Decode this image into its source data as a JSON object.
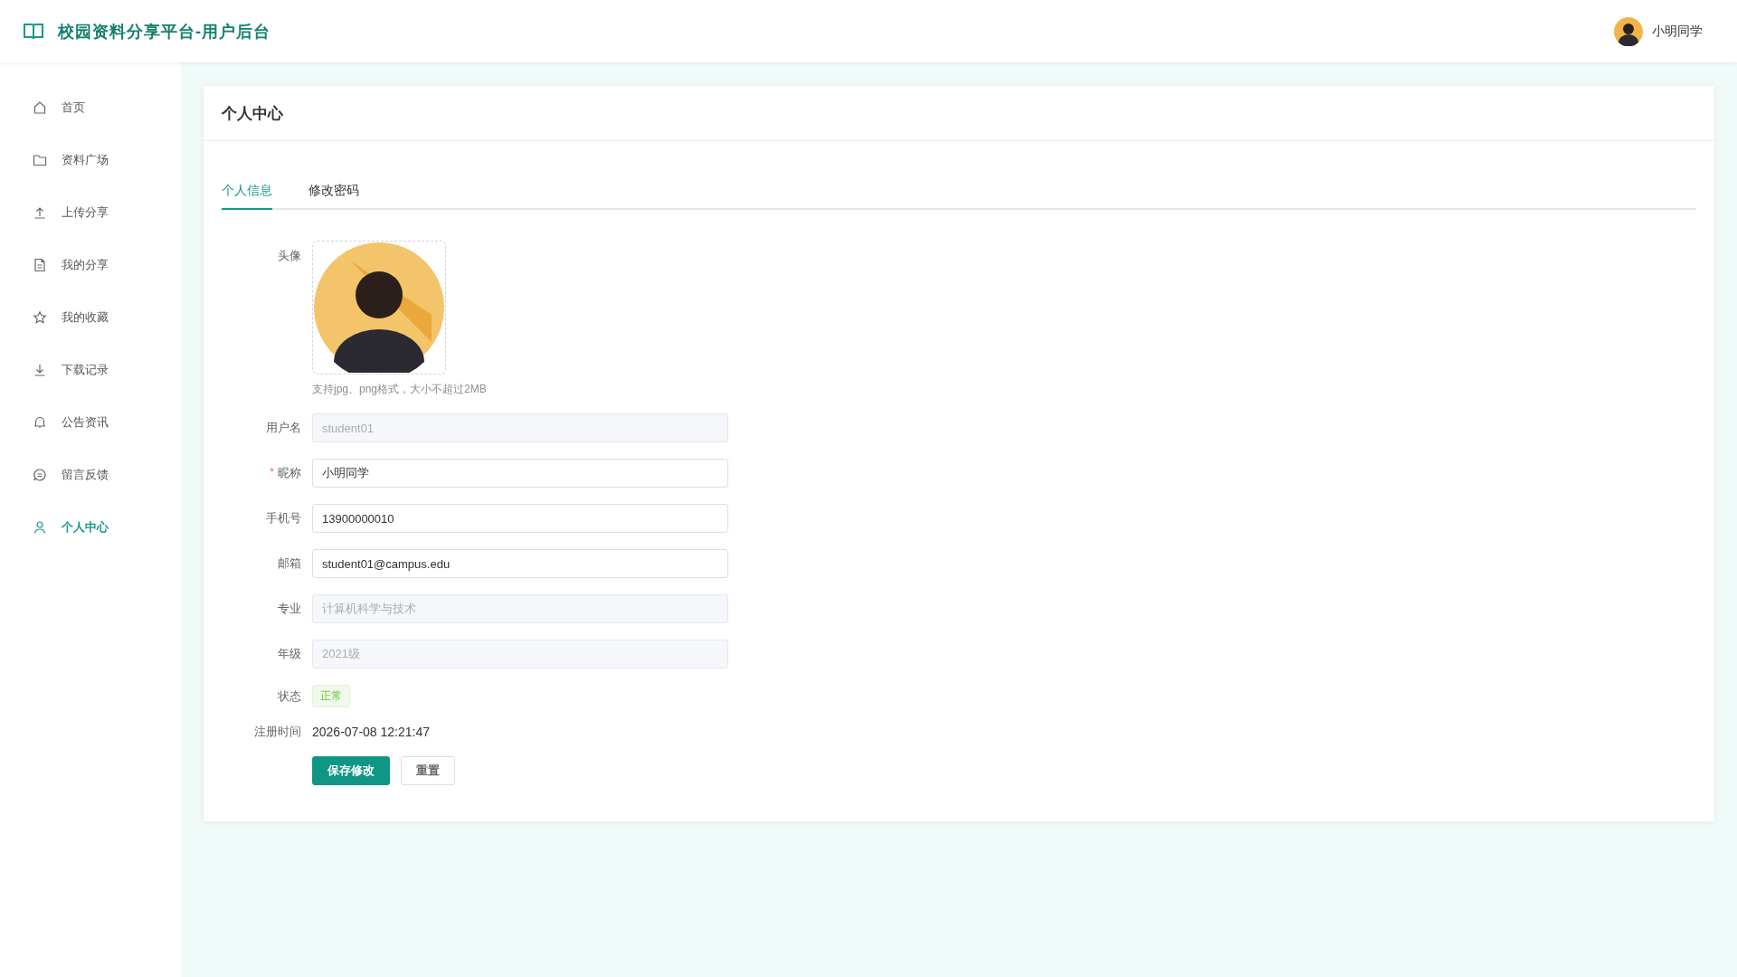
{
  "header": {
    "title": "校园资料分享平台-用户后台",
    "user": "小明同学"
  },
  "sidebar": {
    "items": [
      {
        "label": "首页",
        "selected": false
      },
      {
        "label": "资料广场",
        "selected": false
      },
      {
        "label": "上传分享",
        "selected": false
      },
      {
        "label": "我的分享",
        "selected": false
      },
      {
        "label": "我的收藏",
        "selected": false
      },
      {
        "label": "下载记录",
        "selected": false
      },
      {
        "label": "公告资讯",
        "selected": false
      },
      {
        "label": "留言反馈",
        "selected": false
      },
      {
        "label": "个人中心",
        "selected": true
      }
    ]
  },
  "card": {
    "title": "个人中心",
    "tabs": [
      {
        "label": "个人信息",
        "selected": true
      },
      {
        "label": "修改密码",
        "selected": false
      }
    ],
    "fields": [
      {
        "kind": "avatar",
        "label": "头像",
        "hint": "支持jpg、png格式，大小不超过2MB"
      },
      {
        "kind": "input",
        "label": "用户名",
        "value": "student01",
        "disabled": true
      },
      {
        "kind": "input",
        "label": "昵称",
        "required_mark": "*",
        "value": "小明同学",
        "disabled": false
      },
      {
        "kind": "input",
        "label": "手机号",
        "value": "13900000010",
        "disabled": false
      },
      {
        "kind": "input",
        "label": "邮箱",
        "value": "student01@campus.edu",
        "disabled": false
      },
      {
        "kind": "input",
        "label": "专业",
        "value": "计算机科学与技术",
        "disabled": true
      },
      {
        "kind": "input",
        "label": "年级",
        "value": "2021级",
        "disabled": true
      },
      {
        "kind": "tag",
        "label": "状态",
        "value": "正常"
      },
      {
        "kind": "text",
        "label": "注册时间",
        "value": "2026-07-08 12:21:47"
      }
    ],
    "buttons": [
      {
        "label": "保存修改",
        "kind": "primary"
      },
      {
        "label": "重置",
        "kind": "default"
      }
    ]
  }
}
